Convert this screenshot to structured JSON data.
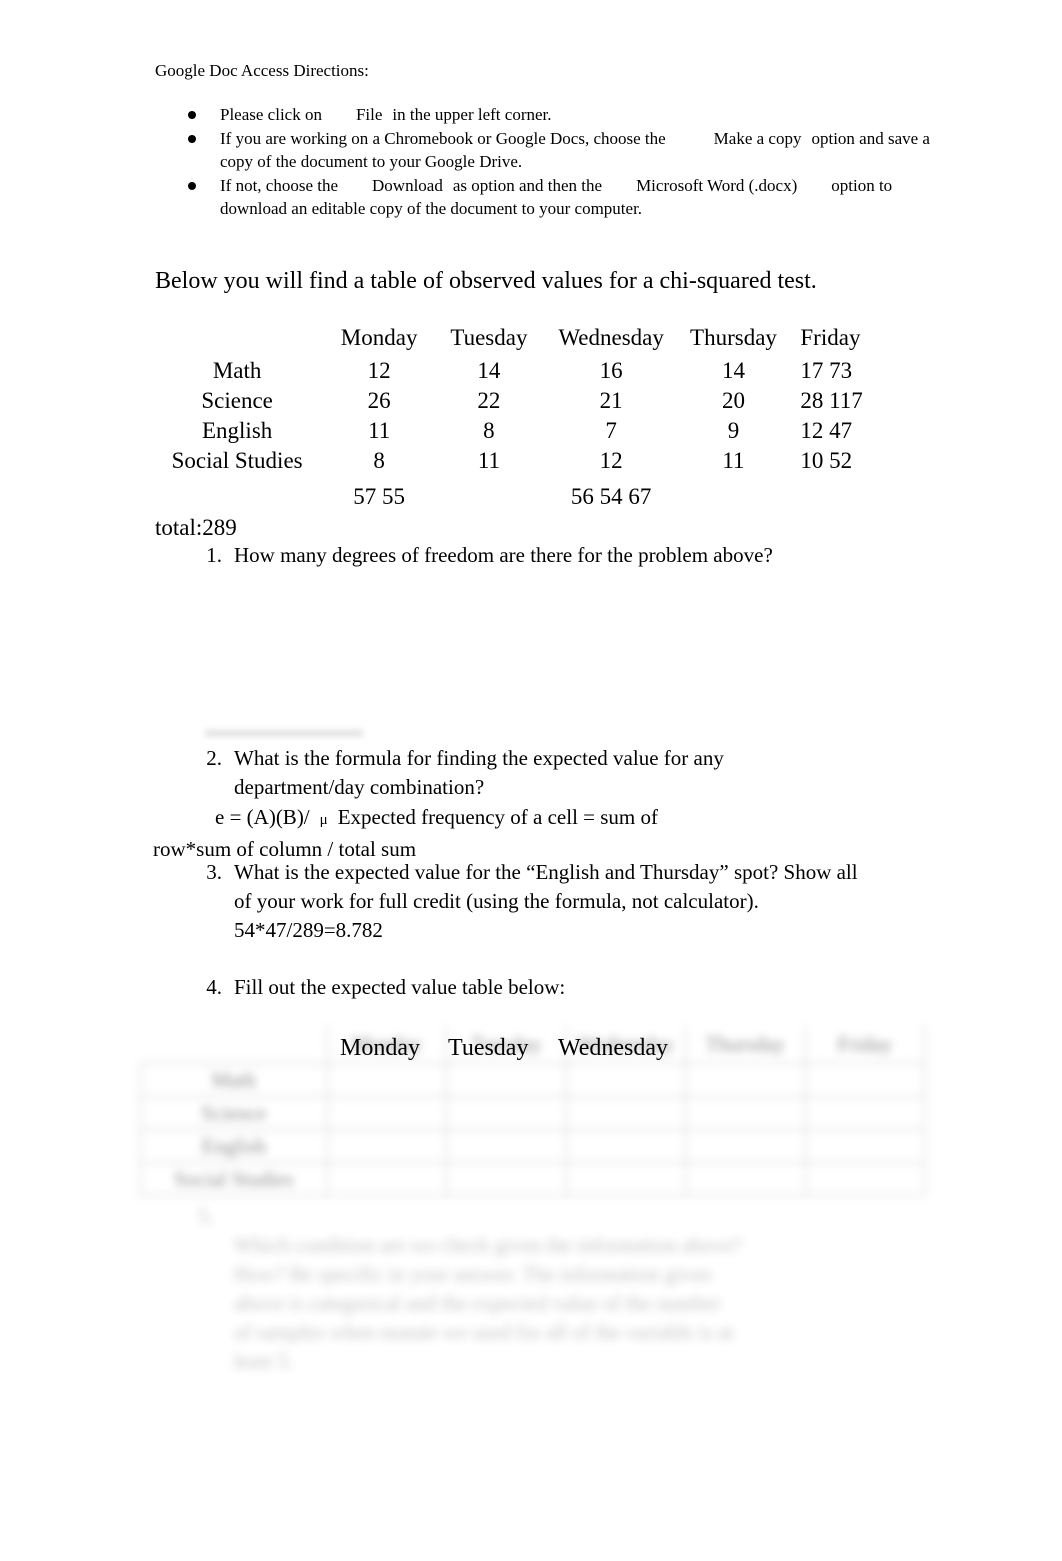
{
  "document": {
    "heading": "Google Doc Access Directions:",
    "directions": [
      {
        "part1": "Please click on",
        "emphasis": "File",
        "part2": "in the upper left corner."
      },
      {
        "part1": "If you are working on a Chromebook or Google Docs, choose the",
        "emphasis": "Make a copy",
        "part2": "option and save a copy of the document to your Google Drive."
      },
      {
        "part1": "If not, choose the",
        "emphasis": "Download",
        "part2": "as option and then the",
        "emphasis2": "Microsoft Word (.docx)",
        "part3": "option to download an editable copy of the document to your computer."
      }
    ],
    "intro": "Below you will find a table of observed values for a chi-squared test.",
    "grand_total": "total:289"
  },
  "observed_table": {
    "columns": [
      "",
      "Monday",
      "Tuesday",
      "Wednesday",
      "Thursday",
      "Friday"
    ],
    "rows": [
      {
        "label": "Math",
        "monday": "12",
        "tuesday": "14",
        "wednesday": "16",
        "thursday": "14",
        "friday": "17 73"
      },
      {
        "label": "Science",
        "monday": "26",
        "tuesday": "22",
        "wednesday": "21",
        "thursday": "20",
        "friday": "28 117"
      },
      {
        "label": "English",
        "monday": "11",
        "tuesday": "8",
        "wednesday": "7",
        "thursday": "9",
        "friday": "12 47"
      },
      {
        "label": "Social Studies",
        "monday": "8",
        "tuesday": "11",
        "wednesday": "12",
        "thursday": "11",
        "friday": "10 52"
      }
    ],
    "totals": {
      "left": "57 55",
      "middle": "56 54 67"
    }
  },
  "questions": [
    {
      "number": "1.",
      "text": "How many degrees of freedom are there for the problem above?"
    },
    {
      "number": "2.",
      "text": "What is the formula for finding the expected value for any department/day combination?",
      "answer_line1": "e = (A)(B)/",
      "answer_mu": "μ",
      "answer_line2": "Expected frequency of a cell = sum of",
      "answer_line3": "row*sum of column / total sum"
    },
    {
      "number": "3.",
      "text": "What is the expected value for the “English and Thursday” spot? Show all of your work for full credit (using the formula, not calculator).",
      "answer": "54*47/289=8.782"
    },
    {
      "number": "4.",
      "text": "Fill out the expected value table below:"
    },
    {
      "number": "5.",
      "text": "(blurred / illegible)",
      "legible": false
    }
  ],
  "expected_table": {
    "columns": [
      "",
      "Monday",
      "Tuesday",
      "Wednesday",
      "Thursday",
      "Friday"
    ],
    "sharp_headers": [
      "Monday",
      "Tuesday",
      "Wednesday"
    ],
    "blurred_headers": [
      "Thursday",
      "Friday"
    ],
    "row_labels": [
      "Math",
      "Science",
      "English",
      "Social Studies"
    ],
    "cells_legible": false,
    "placeholder_rows": [
      {
        "label": "Math",
        "c1": "",
        "c2": "",
        "c3": "",
        "c4": "",
        "c5": ""
      },
      {
        "label": "Science",
        "c1": "",
        "c2": "",
        "c3": "",
        "c4": "",
        "c5": ""
      },
      {
        "label": "English",
        "c1": "",
        "c2": "",
        "c3": "",
        "c4": "",
        "c5": ""
      },
      {
        "label": "Social Studies",
        "c1": "",
        "c2": "",
        "c3": "",
        "c4": "",
        "c5": ""
      }
    ]
  },
  "question5_blurred": {
    "line1": "Which condition are we check given the information above?",
    "line2": "How? Be specific in your answer.  The information given",
    "line3": "above is categorical and        the expected value of the number",
    "line4": "of samples when mutate we used for all of the variable is at",
    "line5": "least 5."
  },
  "colors": {
    "page_background": "#ffffff",
    "text": "#000000",
    "table_border": "#9a9a9a"
  }
}
